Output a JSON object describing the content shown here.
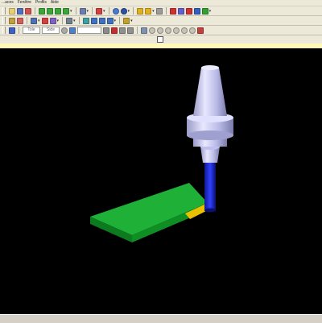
{
  "menu": {
    "items": [
      "...aces",
      "Fenêtre",
      "Profils",
      "Aide"
    ]
  },
  "toolbar3": {
    "field_1": "Tole",
    "field_2": "Side"
  },
  "viewport": {
    "background_color": "#000000",
    "tool_holder_color": "#b8b8e6",
    "tool_color": "#1e2ee0",
    "part_color": "#12a22a",
    "part_highlight_color": "#e8c000"
  },
  "icons": {
    "toolbar1": [
      "open-icon",
      "save-icon",
      "print-icon",
      "green-cube-icon",
      "green-cube-icon",
      "green-cube-icon",
      "green-cube-icon",
      "view-icon",
      "globe-icon",
      "axes-icon",
      "pencil-icon",
      "tool-icon",
      "cube-icon",
      "cube-icon",
      "diamond-icon"
    ],
    "toolbar2": [
      "hammer-icon",
      "arrow-icon",
      "cube-icon",
      "grid-icon",
      "grid-icon",
      "cube-icon",
      "chart-icon",
      "cube-icon",
      "cube-icon",
      "cube-icon",
      "tool-icon"
    ]
  }
}
